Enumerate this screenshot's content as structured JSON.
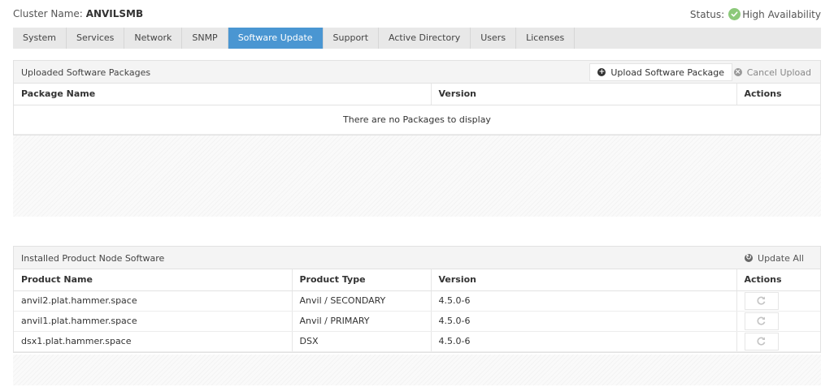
{
  "header": {
    "cluster_label": "Cluster Name:",
    "cluster_name": "ANVILSMB",
    "status_label": "Status:",
    "status_value": "High Availability"
  },
  "tabs": [
    {
      "label": "System",
      "active": false
    },
    {
      "label": "Services",
      "active": false
    },
    {
      "label": "Network",
      "active": false
    },
    {
      "label": "SNMP",
      "active": false
    },
    {
      "label": "Software Update",
      "active": true
    },
    {
      "label": "Support",
      "active": false
    },
    {
      "label": "Active Directory",
      "active": false
    },
    {
      "label": "Users",
      "active": false
    },
    {
      "label": "Licenses",
      "active": false
    }
  ],
  "uploaded": {
    "title": "Uploaded Software Packages",
    "upload_button": "Upload Software Package",
    "cancel_button": "Cancel Upload",
    "columns": [
      "Package Name",
      "Version",
      "Actions"
    ],
    "empty_message": "There are no Packages to display"
  },
  "installed": {
    "title": "Installed Product Node Software",
    "update_all_button": "Update All",
    "columns": [
      "Product Name",
      "Product Type",
      "Version",
      "Actions"
    ],
    "rows": [
      {
        "name": "anvil2.plat.hammer.space",
        "type": "Anvil / SECONDARY",
        "version": "4.5.0-6"
      },
      {
        "name": "anvil1.plat.hammer.space",
        "type": "Anvil / PRIMARY",
        "version": "4.5.0-6"
      },
      {
        "name": "dsx1.plat.hammer.space",
        "type": "DSX",
        "version": "4.5.0-6"
      }
    ]
  },
  "colors": {
    "accent": "#4a96d2",
    "status_ok": "#8cc97a"
  },
  "icons": {
    "status": "check-circle-icon",
    "upload": "plus-circle-icon",
    "cancel": "x-circle-icon",
    "update_all": "refresh-circle-icon",
    "row_action": "refresh-icon"
  }
}
